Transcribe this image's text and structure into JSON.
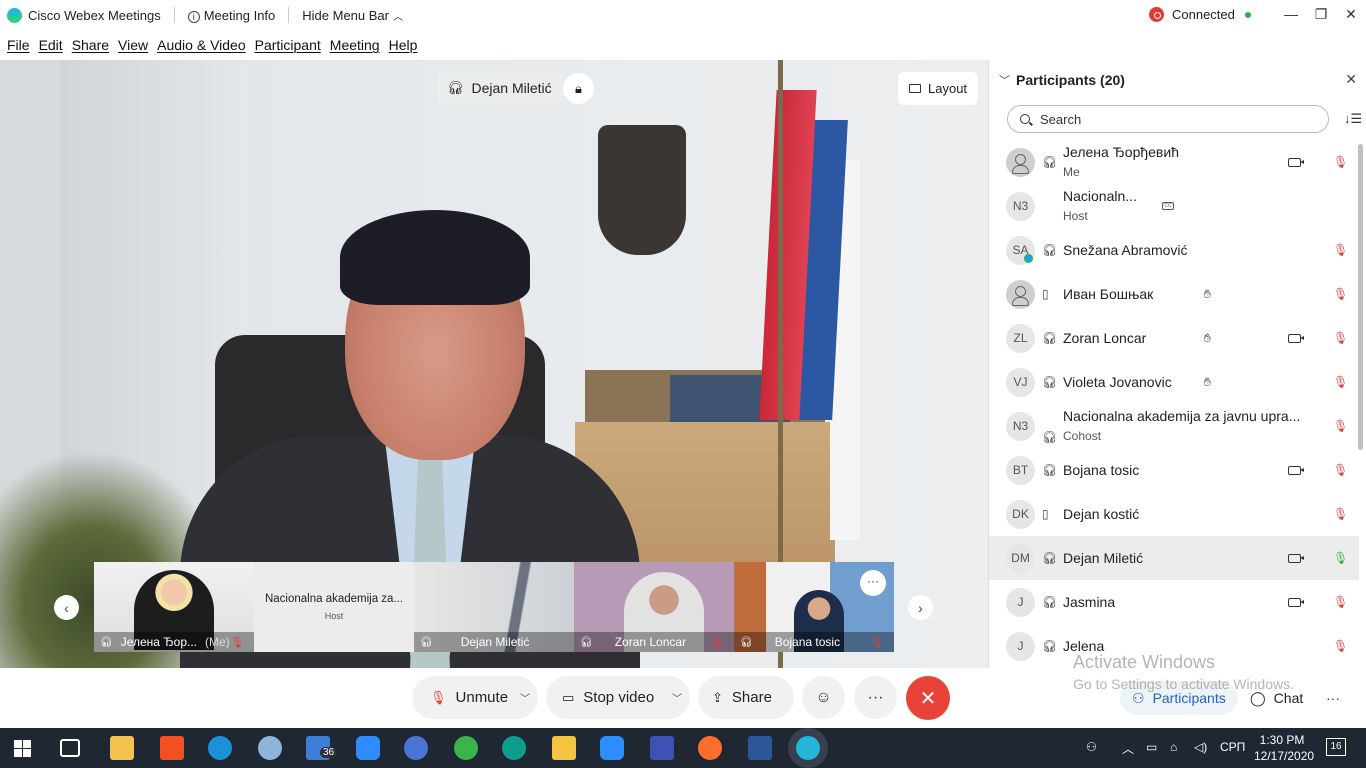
{
  "window": {
    "app_title": "Cisco Webex Meetings",
    "meeting_info_label": "Meeting Info",
    "hide_menu_label": "Hide Menu Bar",
    "status_label": "Connected"
  },
  "menu": [
    "File",
    "Edit",
    "Share",
    "View",
    "Audio & Video",
    "Participant",
    "Meeting",
    "Help"
  ],
  "stage": {
    "active_speaker": "Dejan Miletić",
    "layout_label": "Layout"
  },
  "thumbnails": [
    {
      "name": "Јелена Ђор...",
      "me_label": "(Me)",
      "muted": true
    },
    {
      "name": "Nacionalna akademija za...",
      "role": "Host"
    },
    {
      "name": "Dejan Miletić"
    },
    {
      "name": "Zoran Loncar",
      "muted": true
    },
    {
      "name": "Bojana tosic",
      "muted": true,
      "more_label": "···"
    }
  ],
  "participants_panel": {
    "title": "Participants (20)",
    "search_placeholder": "Search",
    "items": [
      {
        "initials": "",
        "name": "Јелена Ђорђевић",
        "sub": "Me",
        "video": true,
        "muted": true
      },
      {
        "initials": "N3",
        "name": "Nacionaln...",
        "sub": "Host"
      },
      {
        "initials": "SA",
        "name": "Snežana Abramović",
        "muted": true
      },
      {
        "initials": "",
        "name": "Иван Бошњак",
        "hand": true,
        "muted": true
      },
      {
        "initials": "ZL",
        "name": "Zoran Loncar",
        "hand": true,
        "video": true,
        "muted": true
      },
      {
        "initials": "VJ",
        "name": "Violeta Jovanovic",
        "hand": true,
        "muted": true
      },
      {
        "initials": "N3",
        "name": "Nacionalna akademija za javnu upra...",
        "sub": "Cohost",
        "muted": true
      },
      {
        "initials": "BT",
        "name": "Bojana tosic",
        "video": true,
        "muted": true
      },
      {
        "initials": "DK",
        "name": "Dejan kostić",
        "muted": true
      },
      {
        "initials": "DM",
        "name": "Dejan Miletić",
        "video": true,
        "muted": false
      },
      {
        "initials": "J",
        "name": "Jasmina",
        "video": true,
        "muted": true
      },
      {
        "initials": "J",
        "name": "Jelena",
        "muted": true
      }
    ]
  },
  "controls": {
    "unmute_label": "Unmute",
    "stop_video_label": "Stop video",
    "share_label": "Share",
    "participants_tab": "Participants",
    "chat_tab": "Chat"
  },
  "watermark": {
    "line1": "Activate Windows",
    "line2": "Go to Settings to activate Windows."
  },
  "taskbar": {
    "mail_badge": "36",
    "language": "СРП",
    "time": "1:30 PM",
    "date": "12/17/2020",
    "notifications": "16"
  }
}
